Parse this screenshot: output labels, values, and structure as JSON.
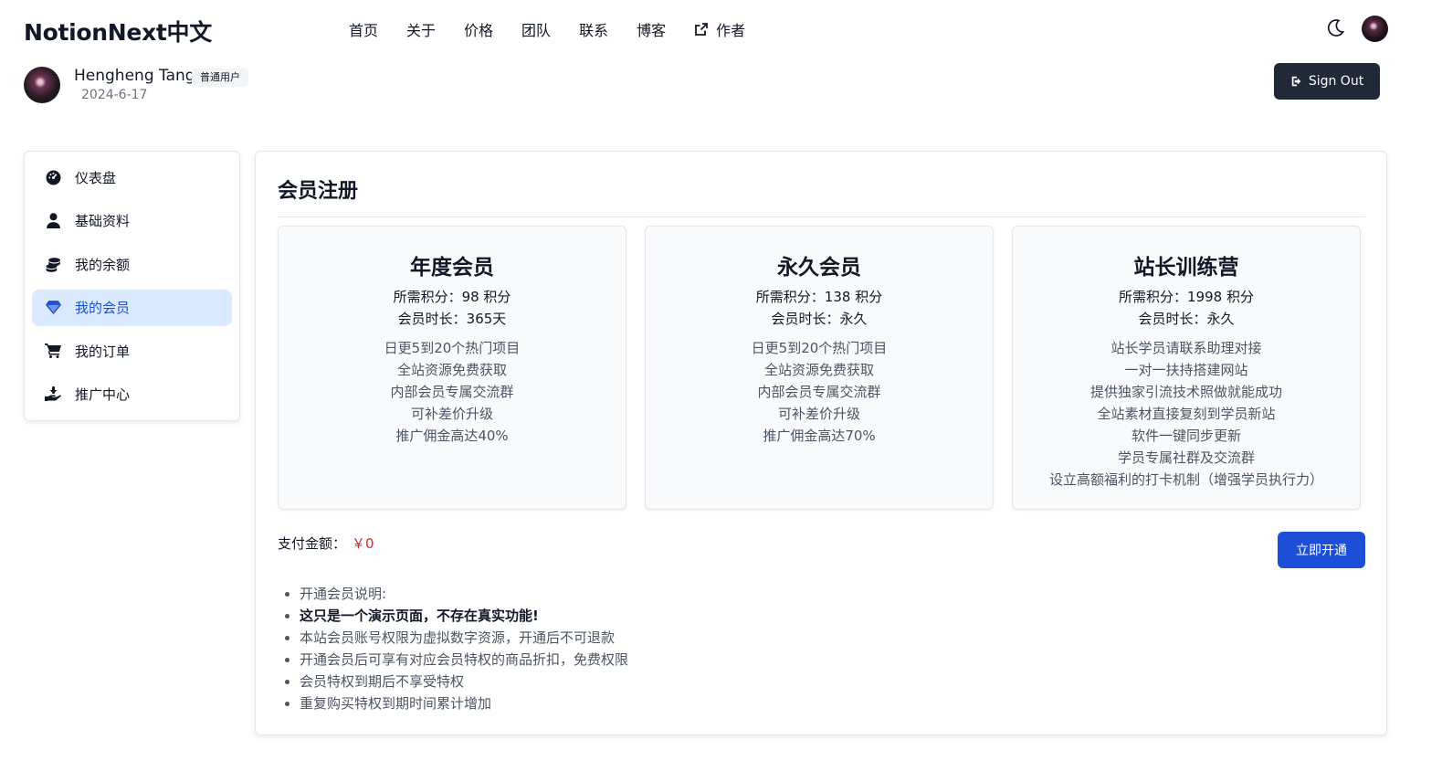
{
  "brand": "NotionNext中文",
  "nav": [
    "首页",
    "关于",
    "价格",
    "团队",
    "联系",
    "博客",
    "作者"
  ],
  "user": {
    "name": "Hengheng Tang",
    "badge": "普通用户",
    "date": "2024-6-17",
    "signout": "Sign Out"
  },
  "sidebar": [
    {
      "label": "仪表盘",
      "icon": "dashboard-icon",
      "active": false
    },
    {
      "label": "基础资料",
      "icon": "user-icon",
      "active": false
    },
    {
      "label": "我的余额",
      "icon": "coins-icon",
      "active": false
    },
    {
      "label": "我的会员",
      "icon": "gem-icon",
      "active": true
    },
    {
      "label": "我的订单",
      "icon": "cart-icon",
      "active": false
    },
    {
      "label": "推广中心",
      "icon": "hand-coin-icon",
      "active": false
    }
  ],
  "main": {
    "title": "会员注册",
    "plans": [
      {
        "title": "年度会员",
        "points": "所需积分：98 积分",
        "duration": "会员时长：365天",
        "features": [
          "日更5到20个热门项目",
          "全站资源免费获取",
          "内部会员专属交流群",
          "可补差价升级",
          "推广佣金高达40%"
        ]
      },
      {
        "title": "永久会员",
        "points": "所需积分：138 积分",
        "duration": "会员时长：永久",
        "features": [
          "日更5到20个热门项目",
          "全站资源免费获取",
          "内部会员专属交流群",
          "可补差价升级",
          "推广佣金高达70%"
        ]
      },
      {
        "title": "站长训练营",
        "points": "所需积分：1998 积分",
        "duration": "会员时长：永久",
        "features": [
          "站长学员请联系助理对接",
          "一对一扶持搭建网站",
          "提供独家引流技术照做就能成功",
          "全站素材直接复刻到学员新站",
          "软件一键同步更新",
          "学员专属社群及交流群",
          "设立高额福利的打卡机制（增强学员执行力）"
        ]
      }
    ],
    "pay_label": "支付金额：",
    "pay_amount": "￥0",
    "open_button": "立即开通",
    "notes": [
      "开通会员说明:",
      "这只是一个演示页面，不存在真实功能!",
      "本站会员账号权限为虚拟数字资源，开通后不可退款",
      "开通会员后可享有对应会员特权的商品折扣，免费权限",
      "会员特权到期后不享受特权",
      "重复购买特权到期时间累计增加"
    ]
  },
  "colors": {
    "primary": "#1d4ed8",
    "active_bg": "#dbeafe",
    "signout_bg": "#1f2937",
    "price": "#dc2626"
  }
}
